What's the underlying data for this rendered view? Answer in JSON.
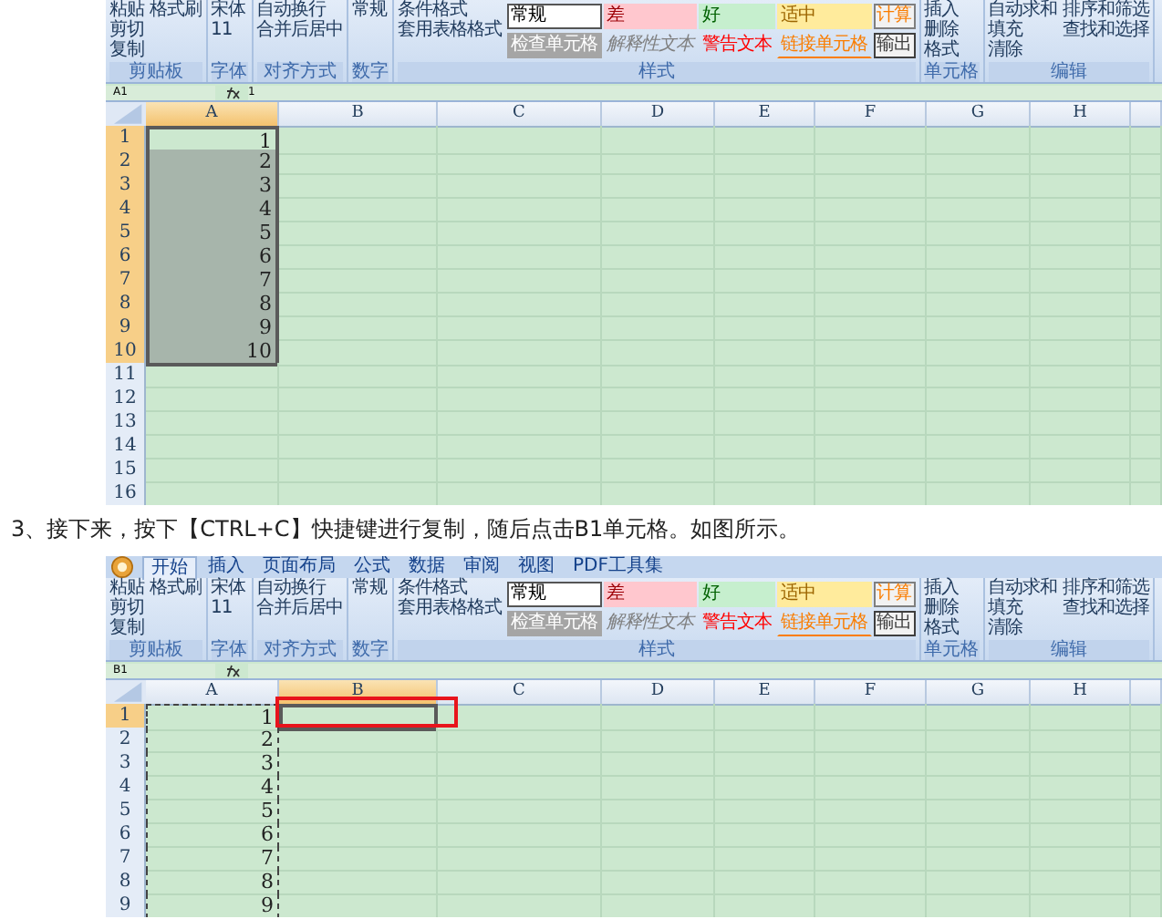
{
  "figures": [
    {
      "ribbon": [
        {
          "label": "剪贴板",
          "items": [
            "粘贴",
            "剪切",
            "复制",
            "格式刷"
          ]
        },
        {
          "label": "字体",
          "items": [
            "宋体",
            "11"
          ]
        },
        {
          "label": "对齐方式",
          "items": [
            "自动换行",
            "合并后居中"
          ]
        },
        {
          "label": "数字",
          "items": [
            "常规"
          ]
        },
        {
          "label": "样式",
          "items": [
            "条件格式",
            "套用表格格式"
          ],
          "styles": [
            {
              "text": "常规",
              "kind": "normal"
            },
            {
              "text": "检查单元格",
              "kind": "check"
            },
            {
              "text": "差",
              "kind": "bad"
            },
            {
              "text": "解释性文本",
              "kind": "explanatory"
            },
            {
              "text": "好",
              "kind": "good"
            },
            {
              "text": "警告文本",
              "kind": "warning"
            },
            {
              "text": "适中",
              "kind": "neutral"
            },
            {
              "text": "链接单元格",
              "kind": "linked"
            },
            {
              "text": "计算",
              "kind": "calculation"
            },
            {
              "text": "输出",
              "kind": "output"
            }
          ]
        },
        {
          "label": "单元格",
          "items": [
            "插入",
            "删除",
            "格式"
          ]
        },
        {
          "label": "编辑",
          "items": [
            "自动求和",
            "填充",
            "清除",
            "排序和筛选",
            "查找和选择"
          ]
        }
      ],
      "name_box": "A1",
      "formula": "1",
      "copy_marquee": false,
      "highlight_box": false,
      "columns": [
        {
          "label": "A",
          "selected": true
        },
        {
          "label": "B",
          "selected": false
        },
        {
          "label": "C",
          "selected": false
        },
        {
          "label": "D",
          "selected": false
        },
        {
          "label": "E",
          "selected": false
        },
        {
          "label": "F",
          "selected": false
        },
        {
          "label": "G",
          "selected": false
        },
        {
          "label": "H",
          "selected": false
        }
      ],
      "rows": [
        {
          "label": "1",
          "value": "1",
          "selected": true
        },
        {
          "label": "2",
          "value": "2",
          "selected": true
        },
        {
          "label": "3",
          "value": "3",
          "selected": true
        },
        {
          "label": "4",
          "value": "4",
          "selected": true
        },
        {
          "label": "5",
          "value": "5",
          "selected": true
        },
        {
          "label": "6",
          "value": "6",
          "selected": true
        },
        {
          "label": "7",
          "value": "7",
          "selected": true
        },
        {
          "label": "8",
          "value": "8",
          "selected": true
        },
        {
          "label": "9",
          "value": "9",
          "selected": true
        },
        {
          "label": "10",
          "value": "10",
          "selected": true
        },
        {
          "label": "11",
          "selected": false
        },
        {
          "label": "12",
          "selected": false
        },
        {
          "label": "13",
          "selected": false
        },
        {
          "label": "14",
          "selected": false
        },
        {
          "label": "15",
          "selected": false
        },
        {
          "label": "16",
          "selected": false
        }
      ]
    },
    {
      "caption": "3、接下来，按下【CTRL+C】快捷键进行复制，随后点击B1单元格。如图所示。"
    },
    {
      "tabs": [
        {
          "label": "开始",
          "selected": true
        },
        {
          "label": "插入",
          "selected": false
        },
        {
          "label": "页面布局",
          "selected": false
        },
        {
          "label": "公式",
          "selected": false
        },
        {
          "label": "数据",
          "selected": false
        },
        {
          "label": "审阅",
          "selected": false
        },
        {
          "label": "视图",
          "selected": false
        },
        {
          "label": "PDF工具集",
          "selected": false
        }
      ],
      "ribbon": [
        {
          "label": "剪贴板",
          "items": [
            "粘贴",
            "剪切",
            "复制",
            "格式刷"
          ]
        },
        {
          "label": "字体",
          "items": [
            "宋体",
            "11"
          ]
        },
        {
          "label": "对齐方式",
          "items": [
            "自动换行",
            "合并后居中"
          ]
        },
        {
          "label": "数字",
          "items": [
            "常规"
          ]
        },
        {
          "label": "样式",
          "items": [
            "条件格式",
            "套用表格格式"
          ],
          "styles": [
            {
              "text": "常规",
              "kind": "normal"
            },
            {
              "text": "检查单元格",
              "kind": "check"
            },
            {
              "text": "差",
              "kind": "bad"
            },
            {
              "text": "解释性文本",
              "kind": "explanatory"
            },
            {
              "text": "好",
              "kind": "good"
            },
            {
              "text": "警告文本",
              "kind": "warning"
            },
            {
              "text": "适中",
              "kind": "neutral"
            },
            {
              "text": "链接单元格",
              "kind": "linked"
            },
            {
              "text": "计算",
              "kind": "calculation"
            },
            {
              "text": "输出",
              "kind": "output"
            }
          ]
        },
        {
          "label": "单元格",
          "items": [
            "插入",
            "删除",
            "格式"
          ]
        },
        {
          "label": "编辑",
          "items": [
            "自动求和",
            "填充",
            "清除",
            "排序和筛选",
            "查找和选择"
          ]
        }
      ],
      "name_box": "B1",
      "copy_marquee": true,
      "highlight_box": true,
      "columns": [
        {
          "label": "A",
          "selected": false
        },
        {
          "label": "B",
          "selected": true
        },
        {
          "label": "C",
          "selected": false
        },
        {
          "label": "D",
          "selected": false
        },
        {
          "label": "E",
          "selected": false
        },
        {
          "label": "F",
          "selected": false
        },
        {
          "label": "G",
          "selected": false
        },
        {
          "label": "H",
          "selected": false
        }
      ],
      "rows": [
        {
          "label": "1",
          "value": "1",
          "selected": true
        },
        {
          "label": "2",
          "value": "2",
          "selected": false
        },
        {
          "label": "3",
          "value": "3",
          "selected": false
        },
        {
          "label": "4",
          "value": "4",
          "selected": false
        },
        {
          "label": "5",
          "value": "5",
          "selected": false
        },
        {
          "label": "6",
          "value": "6",
          "selected": false
        },
        {
          "label": "7",
          "value": "7",
          "selected": false
        },
        {
          "label": "8",
          "value": "8",
          "selected": false
        },
        {
          "label": "9",
          "value": "9",
          "selected": false
        }
      ]
    }
  ]
}
